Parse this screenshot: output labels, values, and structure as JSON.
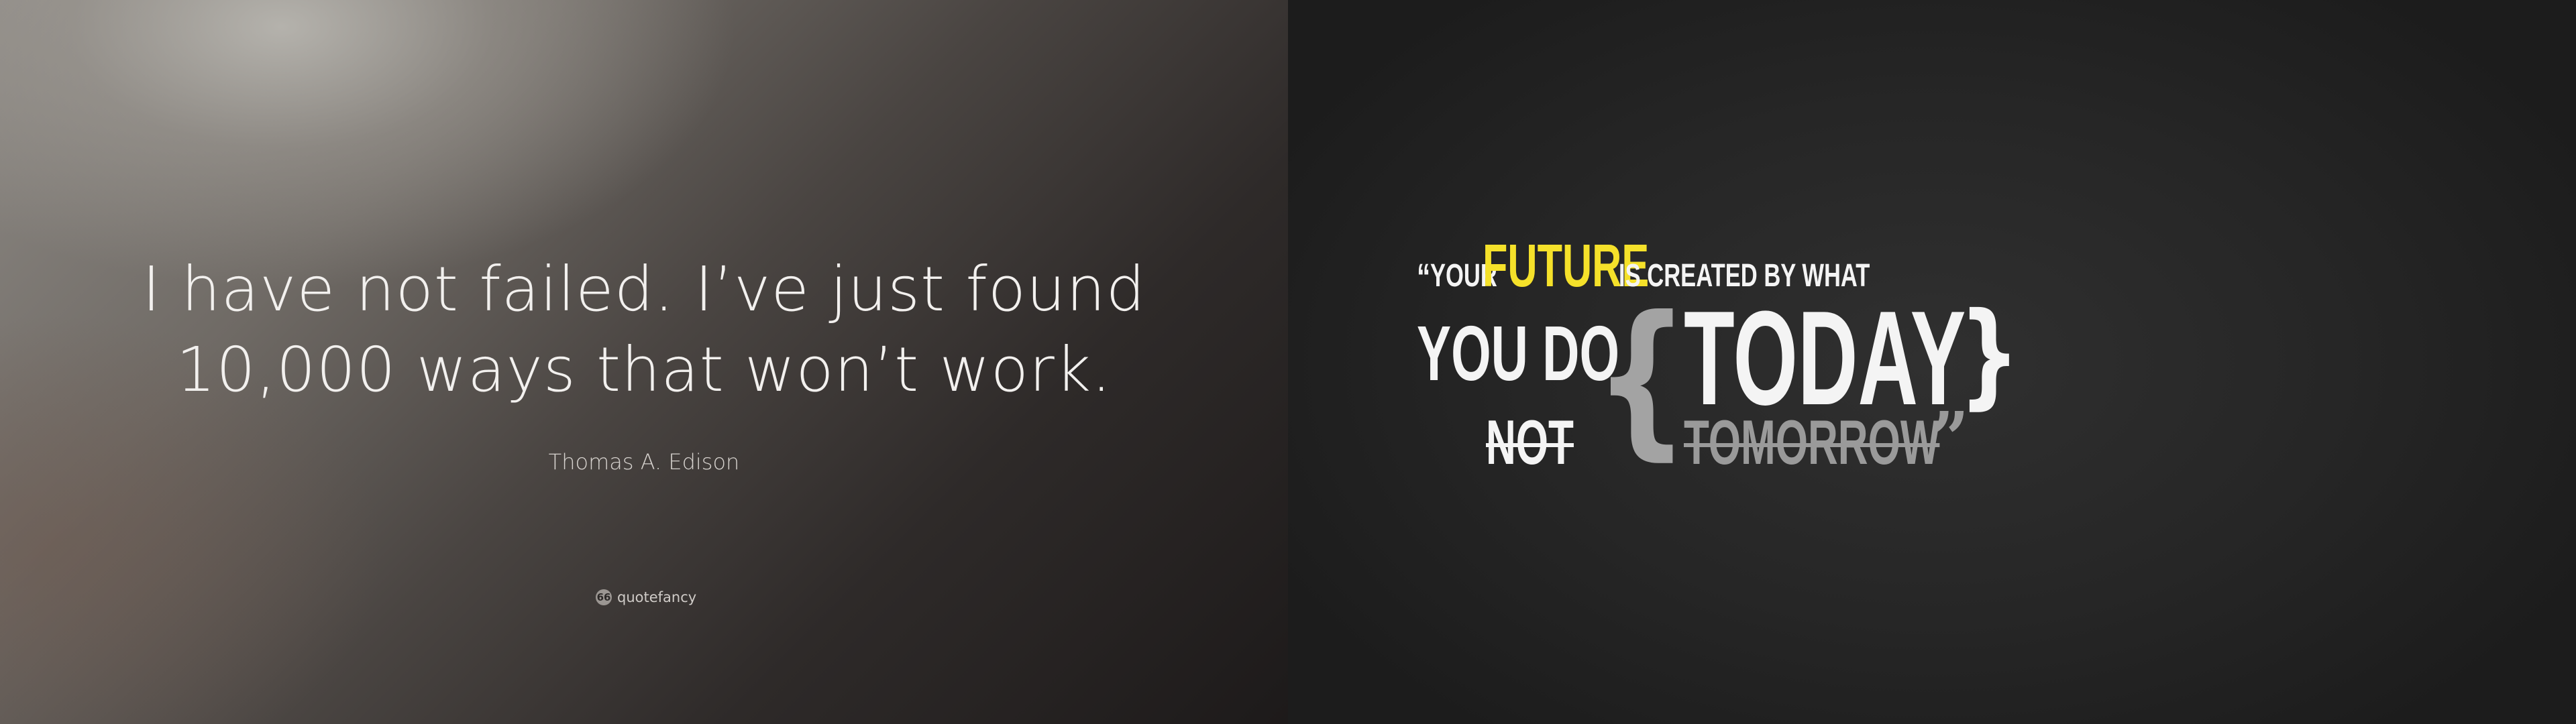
{
  "left_panel": {
    "quote_lines": [
      "I have not failed. I’ve just found",
      "10,000 ways that won’t work."
    ],
    "author": "Thomas A. Edison",
    "brand": {
      "name": "quotefancy",
      "icon": "quote-marks-icon",
      "icon_glyph": "66"
    }
  },
  "right_panel": {
    "open_quote": "“",
    "word_your": "YOUR",
    "word_future": "FUTURE",
    "phrase_created": "IS CREATED BY WHAT",
    "phrase_you_do": "YOU DO",
    "word_not": "NOT",
    "brace_open": "{",
    "word_today": "TODAY",
    "brace_close": "}",
    "word_tomorrow": "TOMORROW",
    "close_quote": "”",
    "colors": {
      "accent_yellow": "#f5e12a",
      "muted_gray": "#9a9a9a",
      "text_white": "#f4f4f4"
    }
  }
}
